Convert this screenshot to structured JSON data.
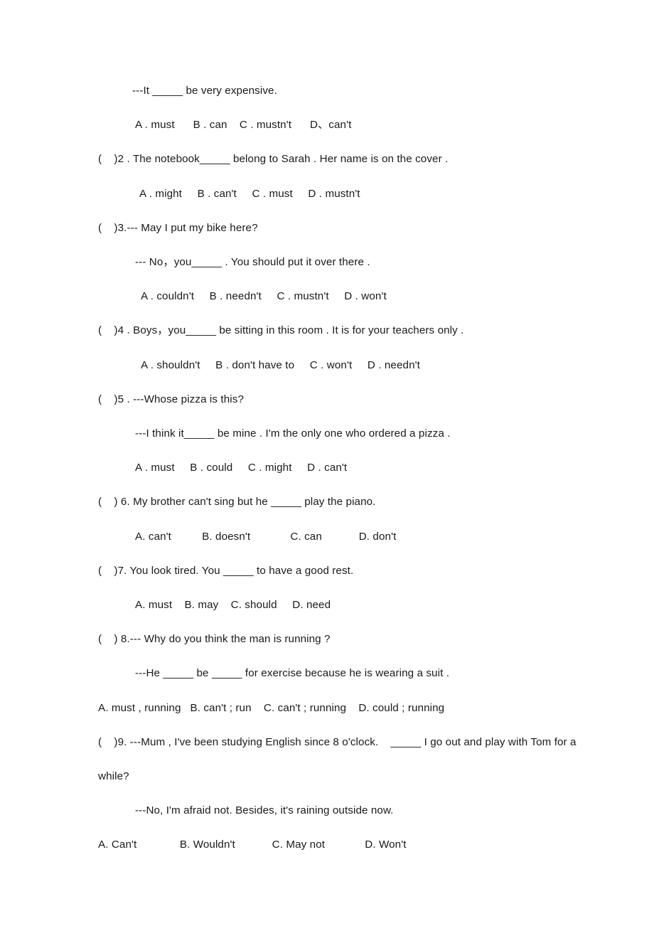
{
  "document": {
    "type": "grammar-worksheet",
    "subject": "English modal verbs multiple choice",
    "page_background": "#ffffff",
    "text_color": "#1a1a1a"
  },
  "lines": [
    {
      "id": "q1_stem_cont",
      "role": "question-stem-continuation",
      "indent": "indent-sm",
      "text": "---It _____ be very expensive."
    },
    {
      "id": "q1_options",
      "role": "option-row",
      "indent": "opt-a",
      "text": "A . must      B . can    C . mustn't      D、can't"
    },
    {
      "id": "q2_stem",
      "role": "question-stem",
      "indent": "flush",
      "text": "(    )2 . The notebook_____ belong to Sarah . Her name is on the cover ."
    },
    {
      "id": "q2_options",
      "role": "option-row",
      "indent": "opt",
      "text": "A . might     B . can't     C . must     D . mustn't"
    },
    {
      "id": "q3_stem",
      "role": "question-stem",
      "indent": "flush",
      "text": "(    )3.--- May I put my bike here?"
    },
    {
      "id": "q3_stem_cont",
      "role": "question-stem-continuation",
      "indent": "indent-md",
      "text": "--- No，you_____ . You should put it over there ."
    },
    {
      "id": "q3_options",
      "role": "option-row",
      "indent": "opt-b",
      "text": "A . couldn't     B . needn't     C . mustn't     D . won't"
    },
    {
      "id": "q4_stem",
      "role": "question-stem",
      "indent": "flush",
      "text": "(    )4 . Boys，you_____ be sitting in this room . It is for your teachers only ."
    },
    {
      "id": "q4_options",
      "role": "option-row",
      "indent": "opt-b",
      "text": "A . shouldn't     B . don't have to     C . won't     D . needn't"
    },
    {
      "id": "q5_stem",
      "role": "question-stem",
      "indent": "flush",
      "text": "(    )5 . ---Whose pizza is this?"
    },
    {
      "id": "q5_stem_cont",
      "role": "question-stem-continuation",
      "indent": "indent-md",
      "text": "---I think it_____ be mine . I'm the only one who ordered a pizza ."
    },
    {
      "id": "q5_options",
      "role": "option-row",
      "indent": "opt-a",
      "text": "A . must     B . could     C . might     D . can't"
    },
    {
      "id": "q6_stem",
      "role": "question-stem",
      "indent": "flush",
      "text": "(    ) 6. My brother can't sing but he _____ play the piano."
    },
    {
      "id": "q6_options",
      "role": "option-row",
      "indent": "opt-a",
      "text": "A. can't          B. doesn't             C. can            D. don't"
    },
    {
      "id": "q7_stem",
      "role": "question-stem",
      "indent": "flush",
      "text": "(    )7. You look tired. You _____ to have a good rest."
    },
    {
      "id": "q7_options",
      "role": "option-row",
      "indent": "opt-a",
      "text": "A. must    B. may    C. should     D. need"
    },
    {
      "id": "q8_stem",
      "role": "question-stem",
      "indent": "flush",
      "text": "(    ) 8.--- Why do you think the man is running ?"
    },
    {
      "id": "q8_stem_cont",
      "role": "question-stem-continuation",
      "indent": "indent-md",
      "text": "---He _____ be _____ for exercise because he is wearing a suit ."
    },
    {
      "id": "q8_options",
      "role": "option-row",
      "indent": "flush",
      "text": "A. must , running   B. can't ; run    C. can't ; running    D. could ; running"
    },
    {
      "id": "q9_stem",
      "role": "question-stem",
      "indent": "flush",
      "text": "(    )9. ---Mum , I've been studying English since 8 o'clock.    _____ I go out and play with Tom for a while?"
    },
    {
      "id": "q9_stem_cont",
      "role": "question-stem-continuation",
      "indent": "indent-md",
      "text": "---No, I'm afraid not. Besides, it's raining outside now."
    },
    {
      "id": "q9_options",
      "role": "option-row",
      "indent": "flush",
      "text": "A. Can't              B. Wouldn't            C. May not             D. Won't"
    }
  ]
}
